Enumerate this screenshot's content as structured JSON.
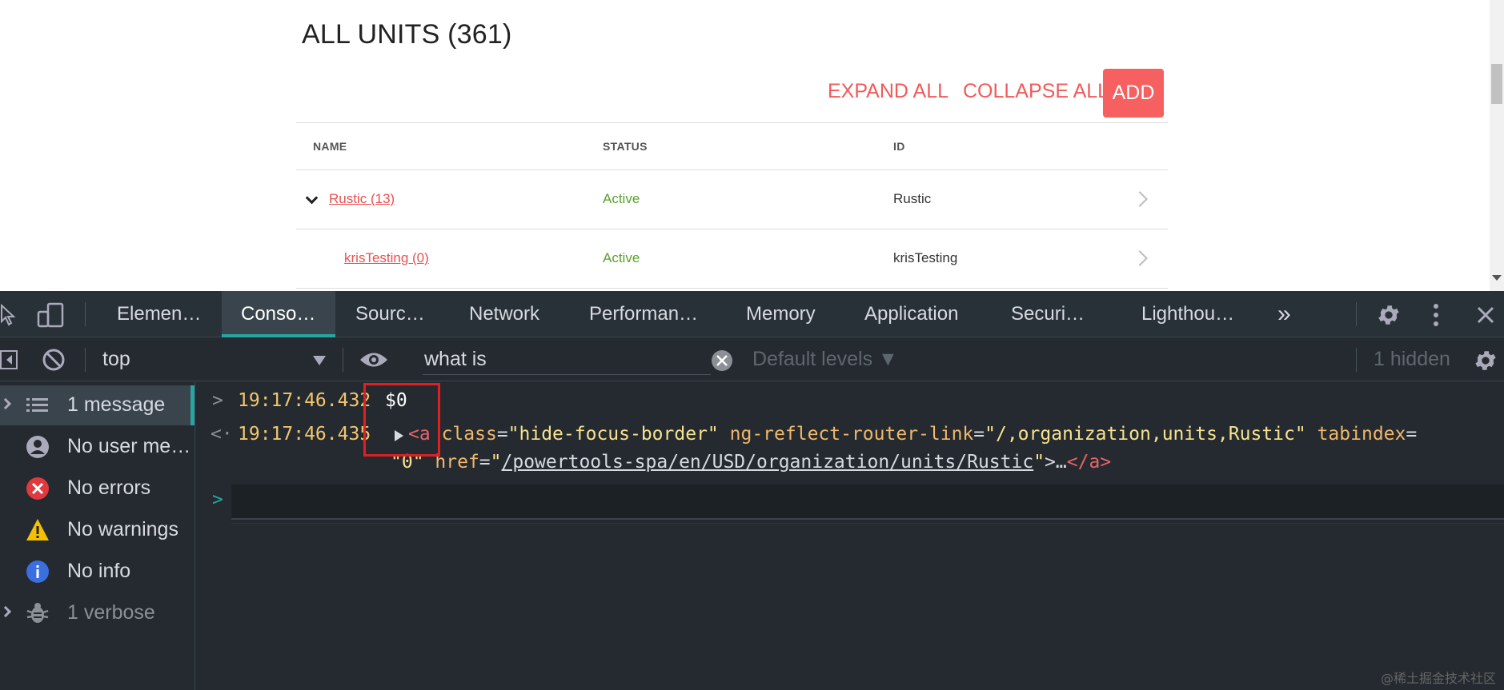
{
  "page": {
    "title": "ALL UNITS (361)",
    "actions": {
      "expand_all": "EXPAND ALL",
      "collapse_all": "COLLAPSE ALL",
      "add": "ADD"
    },
    "table": {
      "columns": [
        "NAME",
        "STATUS",
        "ID"
      ],
      "rows": [
        {
          "name": "Rustic (13)",
          "status": "Active",
          "id": "Rustic",
          "expanded": true
        },
        {
          "name": "krisTesting (0)",
          "status": "Active",
          "id": "krisTesting"
        }
      ]
    }
  },
  "devtools": {
    "tabs": [
      "Elemen…",
      "Conso…",
      "Sourc…",
      "Network",
      "Performan…",
      "Memory",
      "Application",
      "Securi…",
      "Lighthou…"
    ],
    "active_tab": "Conso…",
    "more_tabs": "»",
    "filter": {
      "context": "top",
      "search_value": "what is",
      "levels": "Default levels ▼",
      "hidden": "1 hidden"
    },
    "sidebar": {
      "items": [
        {
          "label": "1 message",
          "icon": "list-icon"
        },
        {
          "label": "No user me…",
          "icon": "user-icon"
        },
        {
          "label": "No errors",
          "icon": "error-icon"
        },
        {
          "label": "No warnings",
          "icon": "warning-icon"
        },
        {
          "label": "No info",
          "icon": "info-icon"
        },
        {
          "label": "1 verbose",
          "icon": "bug-icon"
        }
      ]
    },
    "console": {
      "lines": [
        {
          "timestamp": "19:17:46.432",
          "text": "$0"
        },
        {
          "timestamp": "19:17:46.435"
        }
      ],
      "result": {
        "tag_open": "<a",
        "attr1_name": "class",
        "attr1_value": "\"hide-focus-border\"",
        "attr2_name": "ng-reflect-router-link",
        "attr2_value": "\"/,organization,units,Rustic\"",
        "attr3_name": "tabindex",
        "attr3_value": "\"0\"",
        "attr4_name": "href",
        "attr4_value": "/powertools-spa/en/USD/organization/units/Rustic",
        "tag_mid": ">…",
        "tag_close": "</a>"
      }
    },
    "colors": {
      "accent": "#27a5a0",
      "highlight_box": "#e02020"
    }
  },
  "watermark": "@稀土掘金技术社区"
}
